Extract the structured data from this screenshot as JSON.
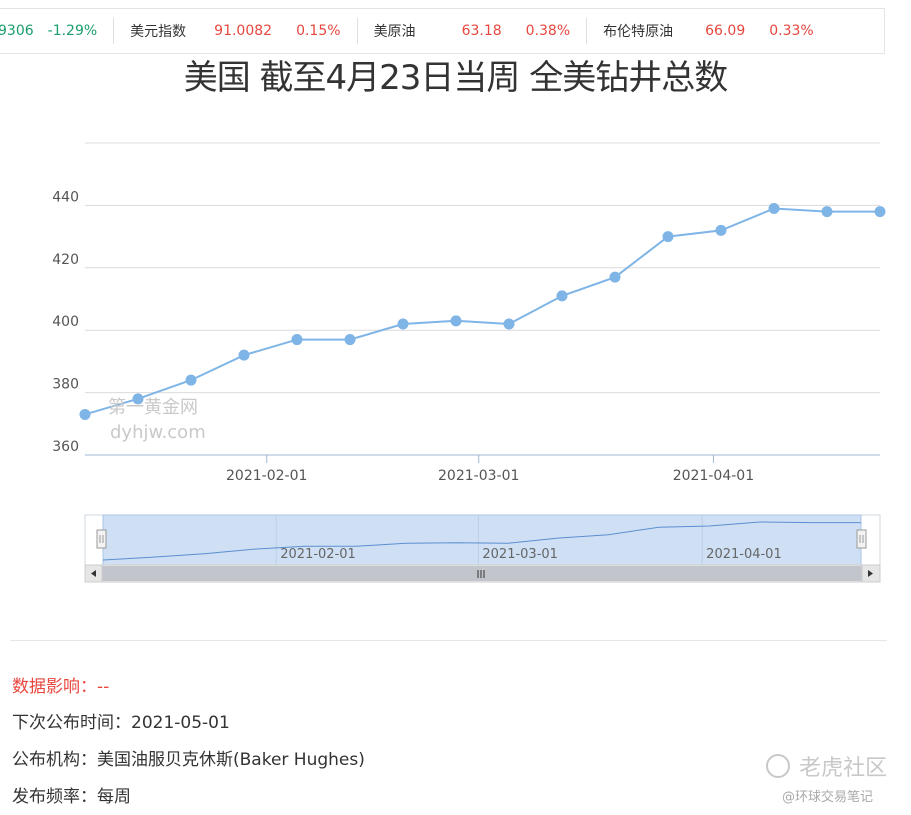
{
  "ticker": [
    {
      "name": "",
      "value": "9306",
      "change": "-1.29%",
      "dir": "down"
    },
    {
      "name": "美元指数",
      "value": "91.0082",
      "change": "0.15%",
      "dir": "up"
    },
    {
      "name": "美原油",
      "value": "63.18",
      "change": "0.38%",
      "dir": "up"
    },
    {
      "name": "布伦特原油",
      "value": "66.09",
      "change": "0.33%",
      "dir": "up"
    }
  ],
  "chart_data": {
    "type": "line",
    "title": "美国 截至4月23日当周 全美钻井总数",
    "x": [
      "2021-01-08",
      "2021-01-15",
      "2021-01-22",
      "2021-01-29",
      "2021-02-05",
      "2021-02-12",
      "2021-02-19",
      "2021-02-26",
      "2021-03-05",
      "2021-03-12",
      "2021-03-19",
      "2021-03-26",
      "2021-04-02",
      "2021-04-09",
      "2021-04-16",
      "2021-04-23"
    ],
    "series": [
      {
        "values": [
          373,
          378,
          384,
          392,
          397,
          397,
          402,
          403,
          402,
          411,
          417,
          430,
          432,
          439,
          438,
          438
        ]
      }
    ],
    "x_tick_labels": [
      "2021-02-01",
      "2021-03-01",
      "2021-04-01"
    ],
    "y_ticks": [
      360,
      380,
      400,
      420,
      440
    ],
    "ylim": [
      360,
      460
    ],
    "grid": true,
    "line_color": "#7eb5e6",
    "navigator_labels": [
      "2021-02-01",
      "2021-03-01",
      "2021-04-01"
    ]
  },
  "info": {
    "impact_label": "数据影响：--",
    "next_release": "下次公布时间：2021-05-01",
    "publisher": "公布机构：美国油服贝克休斯(Baker Hughes)",
    "frequency": "发布频率：每周"
  },
  "watermarks": {
    "site_cn": "第一黄金网",
    "site_url": "dyhjw.com",
    "community": "老虎社区",
    "author": "@环球交易笔记"
  }
}
